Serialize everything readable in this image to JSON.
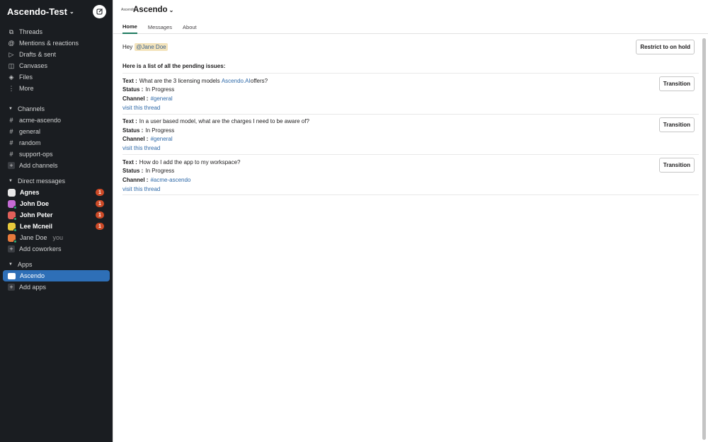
{
  "workspace": {
    "name": "Ascendo-Test"
  },
  "nav": [
    {
      "label": "Threads",
      "icon": "threads-icon",
      "glyph": "⧉"
    },
    {
      "label": "Mentions & reactions",
      "icon": "at-icon",
      "glyph": "@"
    },
    {
      "label": "Drafts & sent",
      "icon": "send-icon",
      "glyph": "▷"
    },
    {
      "label": "Canvases",
      "icon": "canvas-icon",
      "glyph": "◫"
    },
    {
      "label": "Files",
      "icon": "files-icon",
      "glyph": "◈"
    },
    {
      "label": "More",
      "icon": "more-icon",
      "glyph": "⋮"
    }
  ],
  "channels": {
    "title": "Channels",
    "items": [
      "acme-ascendo",
      "general",
      "random",
      "support-ops"
    ],
    "add": "Add channels"
  },
  "dms": {
    "title": "Direct messages",
    "items": [
      {
        "name": "Agnes",
        "badge": "1",
        "color": "#e8e8e8"
      },
      {
        "name": "John Doe",
        "badge": "1",
        "color": "#c46bd4"
      },
      {
        "name": "John Peter",
        "badge": "1",
        "color": "#e0605a"
      },
      {
        "name": "Lee Mcneil",
        "badge": "1",
        "color": "#e8c93c"
      }
    ],
    "self": {
      "name": "Jane Doe",
      "suffix": "you"
    },
    "add": "Add coworkers"
  },
  "apps": {
    "title": "Apps",
    "active": "Ascendo",
    "add": "Add apps"
  },
  "app_header": {
    "logo_text": "Ascendo",
    "title": "Ascendo"
  },
  "tabs": [
    "Home",
    "Messages",
    "About"
  ],
  "greeting": {
    "prefix": "Hey",
    "mention": "@Jane Doe",
    "button": "Restrict to on hold"
  },
  "intro": "Here is a list of all the pending issues:",
  "issue_labels": {
    "text": "Text :",
    "status": "Status :",
    "channel": "Channel :",
    "visit": "visit this thread",
    "button": "Transition"
  },
  "issues": [
    {
      "text_before": "What are the 3 licensing models ",
      "text_link": "Ascendo.AI",
      "text_after": " offers?",
      "status": "In Progress",
      "channel": "#general"
    },
    {
      "text_before": "In a user based model, what are the charges I need to be aware of?",
      "text_link": "",
      "text_after": "",
      "status": "In Progress",
      "channel": "#general"
    },
    {
      "text_before": "How do I add the app to my workspace?",
      "text_link": "",
      "text_after": "",
      "status": "In Progress",
      "channel": "#acme-ascendo"
    }
  ],
  "colors": {
    "sidebar_bg": "#1a1d21",
    "active_blue": "#2e6fb7",
    "badge_red": "#cd4a27",
    "link": "#2e69a8",
    "tab_underline": "#1e7a5f"
  }
}
